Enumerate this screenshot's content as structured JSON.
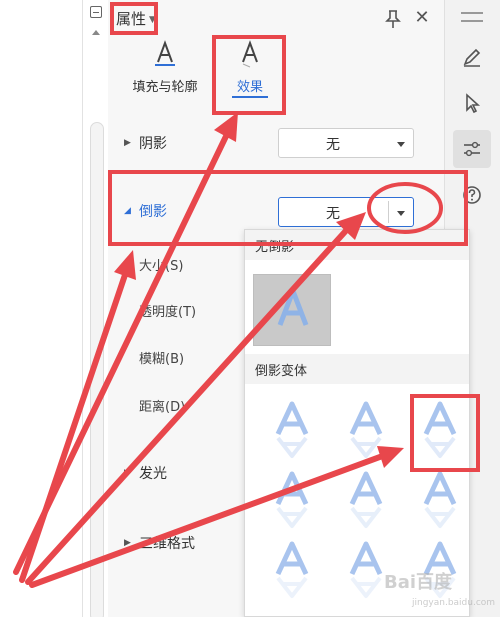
{
  "panel": {
    "title": "属性",
    "tabs": [
      {
        "label": "填充与轮廓"
      },
      {
        "label": "效果"
      }
    ],
    "sections": {
      "shadow": {
        "label": "阴影",
        "value": "无"
      },
      "reflection": {
        "label": "倒影",
        "value": "无",
        "sub_items": [
          "大小(S)",
          "透明度(T)",
          "模糊(B)",
          "距离(D)"
        ]
      },
      "glow": {
        "label": "发光"
      },
      "three_d": {
        "label": "三维格式"
      }
    }
  },
  "popup": {
    "no_reflection_label": "无倒影",
    "variants_label": "倒影变体"
  },
  "watermark": {
    "text": "Bai百度",
    "sub": "jingyan.baidu.com"
  },
  "colors": {
    "accent": "#2f6fd6",
    "annotation": "#e8474c"
  },
  "icons": {
    "pin": "pin-icon",
    "close": "close-icon",
    "pen": "pen-icon",
    "cursor": "cursor-icon",
    "sliders": "sliders-icon",
    "help": "help-icon"
  }
}
